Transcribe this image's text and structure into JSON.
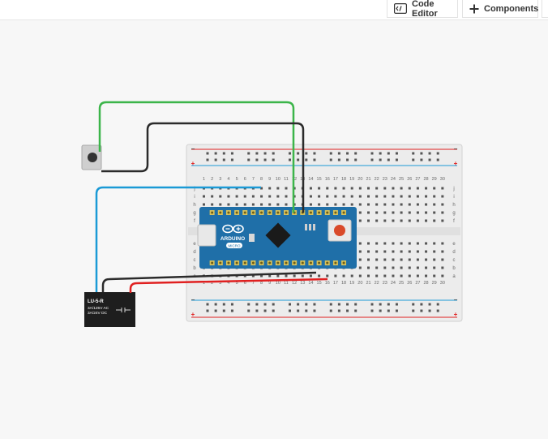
{
  "toolbar": {
    "code_editor_label": "Code Editor",
    "components_label": "Components"
  },
  "breadboard": {
    "column_numbers": [
      "1",
      "2",
      "3",
      "4",
      "5",
      "6",
      "7",
      "8",
      "9",
      "10",
      "11",
      "12",
      "13",
      "14",
      "15",
      "16",
      "17",
      "18",
      "19",
      "20",
      "21",
      "22",
      "23",
      "24",
      "25",
      "26",
      "27",
      "28",
      "29",
      "30"
    ],
    "row_letters_top": [
      "j",
      "i",
      "h",
      "g",
      "f"
    ],
    "row_letters_bottom": [
      "e",
      "d",
      "c",
      "b",
      "a"
    ],
    "rail_plus": "+",
    "rail_minus": "−"
  },
  "arduino": {
    "brand": "ARDUINO",
    "model": "MICRO"
  },
  "relay": {
    "model": "LU-5-R",
    "rating_ac": "3A/125V AC",
    "rating_dc": "3A/24V  DC"
  },
  "colors": {
    "wire_green": "#3cb54a",
    "wire_black": "#2b2b2b",
    "wire_blue": "#1b9ad6",
    "wire_red": "#e02020",
    "board_blue": "#1f6fa8",
    "breadboard": "#ececec"
  }
}
